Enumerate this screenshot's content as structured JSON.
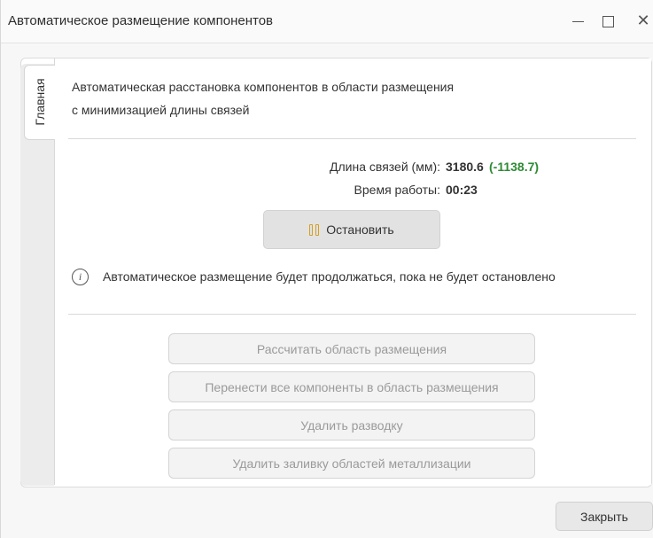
{
  "window": {
    "title": "Автоматическое размещение компонентов",
    "controls": [
      "minimize-icon",
      "maximize-icon",
      "close-icon"
    ]
  },
  "tabs": [
    {
      "label": "Главная",
      "selected": true
    }
  ],
  "main": {
    "description_line1": "Автоматическая расстановка компонентов в области размещения",
    "description_line2": "с минимизацией длины связей",
    "wire_length_label": "Длина связей (мм):",
    "wire_length_value": "3180.6",
    "wire_length_delta": "(-1138.7)",
    "run_time_label": "Время работы:",
    "run_time_value": "00:23",
    "stop_button_label": "Остановить",
    "info_text": "Автоматическое размещение будет продолжаться, пока не будет остановлено"
  },
  "actions": [
    {
      "label": "Рассчитать область размещения",
      "enabled": false
    },
    {
      "label": "Перенести все компоненты в область размещения",
      "enabled": false
    },
    {
      "label": "Удалить разводку",
      "enabled": false
    },
    {
      "label": "Удалить заливку областей металлизации",
      "enabled": false
    }
  ],
  "footer": {
    "close_button_label": "Закрыть"
  },
  "colors": {
    "delta_positive": "#2e8b34",
    "pause_icon": "#d4a020",
    "disabled_text": "#9a9a9a"
  },
  "icons": {
    "pause": "pause-icon",
    "info": "info-icon"
  }
}
